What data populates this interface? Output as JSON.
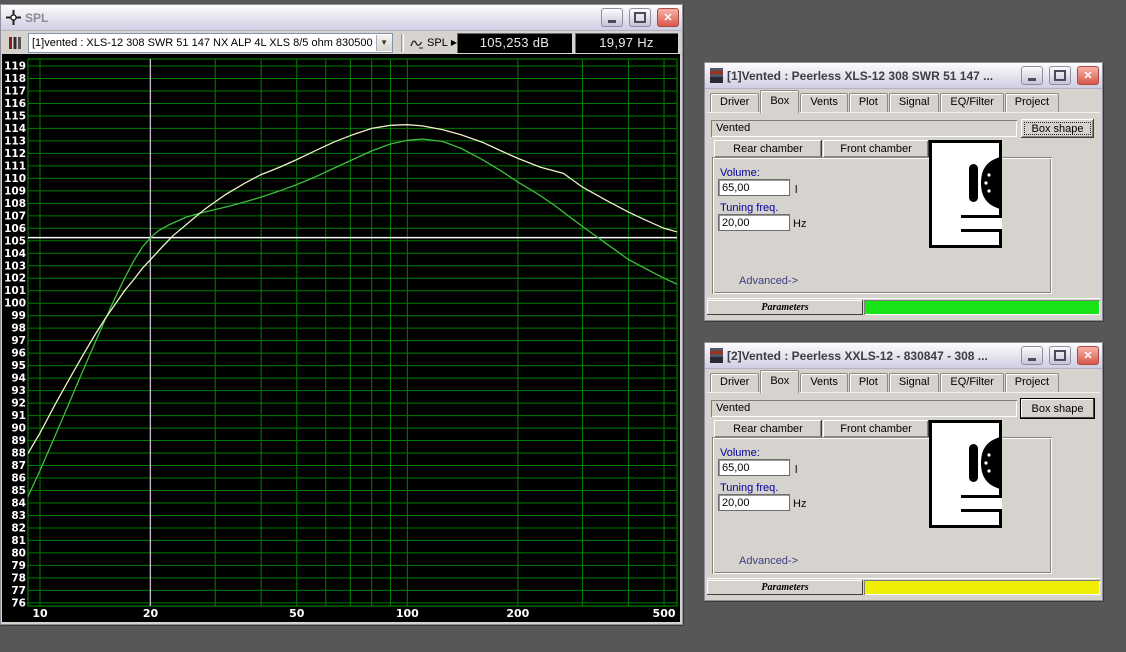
{
  "desktop": {
    "background": "#575757"
  },
  "spl_window": {
    "title": "SPL",
    "toolbar": {
      "curve_selector_value": "[1]vented : XLS-12 308 SWR 51 147 NX ALP 4L XLS 8/5 ohm 830500",
      "plot_type_label": "SPL",
      "readout_db": "105,253 dB",
      "readout_hz": "19,97 Hz"
    }
  },
  "chart_data": {
    "type": "line",
    "title": "SPL",
    "x_axis": {
      "scale": "log",
      "unit": "Hz",
      "range": [
        9.2,
        545
      ],
      "tick_labels": [
        10,
        20,
        50,
        100,
        200,
        500
      ],
      "gridlines": [
        10,
        20,
        30,
        40,
        50,
        60,
        70,
        80,
        90,
        100,
        200,
        300,
        400,
        500
      ]
    },
    "y_axis": {
      "unit": "dB",
      "min": 76,
      "max": 119,
      "step": 1
    },
    "grid": true,
    "grid_color": "#007d00",
    "frame_color": "#009200",
    "bg_color": "#000000",
    "tick_text_color": "#ffffff",
    "cursor": {
      "h_line_db": 105.253,
      "v_line_hz": 19.97,
      "h_color": "#f8f8f8",
      "v_color": "#d9c0e2"
    },
    "series": [
      {
        "name": "[1]vented : XLS-12 308 SWR 51 147 NX ALP 4L XLS 8/5 ohm 830500",
        "color": "#3fbc3f",
        "points": [
          [
            9.2,
            84.3
          ],
          [
            10,
            86.6
          ],
          [
            11,
            89.4
          ],
          [
            12,
            92.0
          ],
          [
            13,
            94.4
          ],
          [
            14,
            96.6
          ],
          [
            15,
            98.6
          ],
          [
            16,
            100.4
          ],
          [
            17,
            102.0
          ],
          [
            18,
            103.4
          ],
          [
            19,
            104.5
          ],
          [
            20,
            105.25
          ],
          [
            21,
            105.8
          ],
          [
            22.5,
            106.3
          ],
          [
            25,
            106.9
          ],
          [
            28,
            107.3
          ],
          [
            32,
            107.7
          ],
          [
            36,
            108.1
          ],
          [
            40,
            108.5
          ],
          [
            45,
            109.0
          ],
          [
            50,
            109.5
          ],
          [
            56,
            110.1
          ],
          [
            63,
            110.8
          ],
          [
            71,
            111.5
          ],
          [
            80,
            112.2
          ],
          [
            90,
            112.75
          ],
          [
            100,
            113.05
          ],
          [
            110,
            113.15
          ],
          [
            125,
            112.95
          ],
          [
            140,
            112.4
          ],
          [
            160,
            111.5
          ],
          [
            180,
            110.6
          ],
          [
            200,
            109.7
          ],
          [
            225,
            108.8
          ],
          [
            250,
            107.9
          ],
          [
            280,
            106.8
          ],
          [
            315,
            105.7
          ],
          [
            355,
            104.6
          ],
          [
            400,
            103.5
          ],
          [
            450,
            102.7
          ],
          [
            500,
            102.0
          ],
          [
            545,
            101.5
          ]
        ]
      },
      {
        "name": "[2]Vented : Peerless XXLS-12 - 830847 - 308",
        "color": "#efefc8",
        "points": [
          [
            9.2,
            87.8
          ],
          [
            10,
            89.6
          ],
          [
            11,
            91.9
          ],
          [
            12,
            93.9
          ],
          [
            13,
            95.7
          ],
          [
            14,
            97.3
          ],
          [
            15,
            98.7
          ],
          [
            16,
            99.9
          ],
          [
            17,
            101.0
          ],
          [
            18,
            101.9
          ],
          [
            19,
            102.8
          ],
          [
            20,
            103.5
          ],
          [
            21.5,
            104.5
          ],
          [
            23,
            105.4
          ],
          [
            25,
            106.3
          ],
          [
            28,
            107.5
          ],
          [
            32,
            108.7
          ],
          [
            36,
            109.6
          ],
          [
            40,
            110.3
          ],
          [
            45,
            110.9
          ],
          [
            50,
            111.5
          ],
          [
            56,
            112.2
          ],
          [
            63,
            112.9
          ],
          [
            71,
            113.5
          ],
          [
            80,
            114.0
          ],
          [
            90,
            114.25
          ],
          [
            100,
            114.3
          ],
          [
            110,
            114.2
          ],
          [
            125,
            113.9
          ],
          [
            140,
            113.5
          ],
          [
            160,
            112.9
          ],
          [
            180,
            112.2
          ],
          [
            200,
            111.6
          ],
          [
            230,
            110.9
          ],
          [
            266,
            110.4
          ],
          [
            300,
            109.3
          ],
          [
            350,
            108.2
          ],
          [
            400,
            107.3
          ],
          [
            450,
            106.6
          ],
          [
            500,
            106.0
          ],
          [
            545,
            105.7
          ]
        ]
      }
    ]
  },
  "windows": [
    {
      "title": "[1]Vented : Peerless XLS-12 308 SWR 51 147 ...",
      "tabs": [
        "Driver",
        "Box",
        "Vents",
        "Plot",
        "Signal",
        "EQ/Filter",
        "Project"
      ],
      "active_tab": "Box",
      "enclosure_type": "Vented",
      "box_shape_button": "Box shape",
      "rear_chamber_button": "Rear chamber",
      "front_chamber_button": "Front chamber",
      "volume_label": "Volume:",
      "volume_value": "65,00",
      "volume_unit": "l",
      "tuning_label": "Tuning freq.",
      "tuning_value": "20,00",
      "tuning_unit": "Hz",
      "advanced_link": "Advanced->",
      "status_button": "Parameters",
      "progress_color": "#17e317",
      "box_shape_focused": true
    },
    {
      "title": "[2]Vented : Peerless XXLS-12 - 830847 - 308 ...",
      "tabs": [
        "Driver",
        "Box",
        "Vents",
        "Plot",
        "Signal",
        "EQ/Filter",
        "Project"
      ],
      "active_tab": "Box",
      "enclosure_type": "Vented",
      "box_shape_button": "Box shape",
      "rear_chamber_button": "Rear chamber",
      "front_chamber_button": "Front chamber",
      "volume_label": "Volume:",
      "volume_value": "65,00",
      "volume_unit": "l",
      "tuning_label": "Tuning freq.",
      "tuning_value": "20,00",
      "tuning_unit": "Hz",
      "advanced_link": "Advanced->",
      "status_button": "Parameters",
      "progress_color": "#f1ee06",
      "box_shape_focused": false
    }
  ]
}
